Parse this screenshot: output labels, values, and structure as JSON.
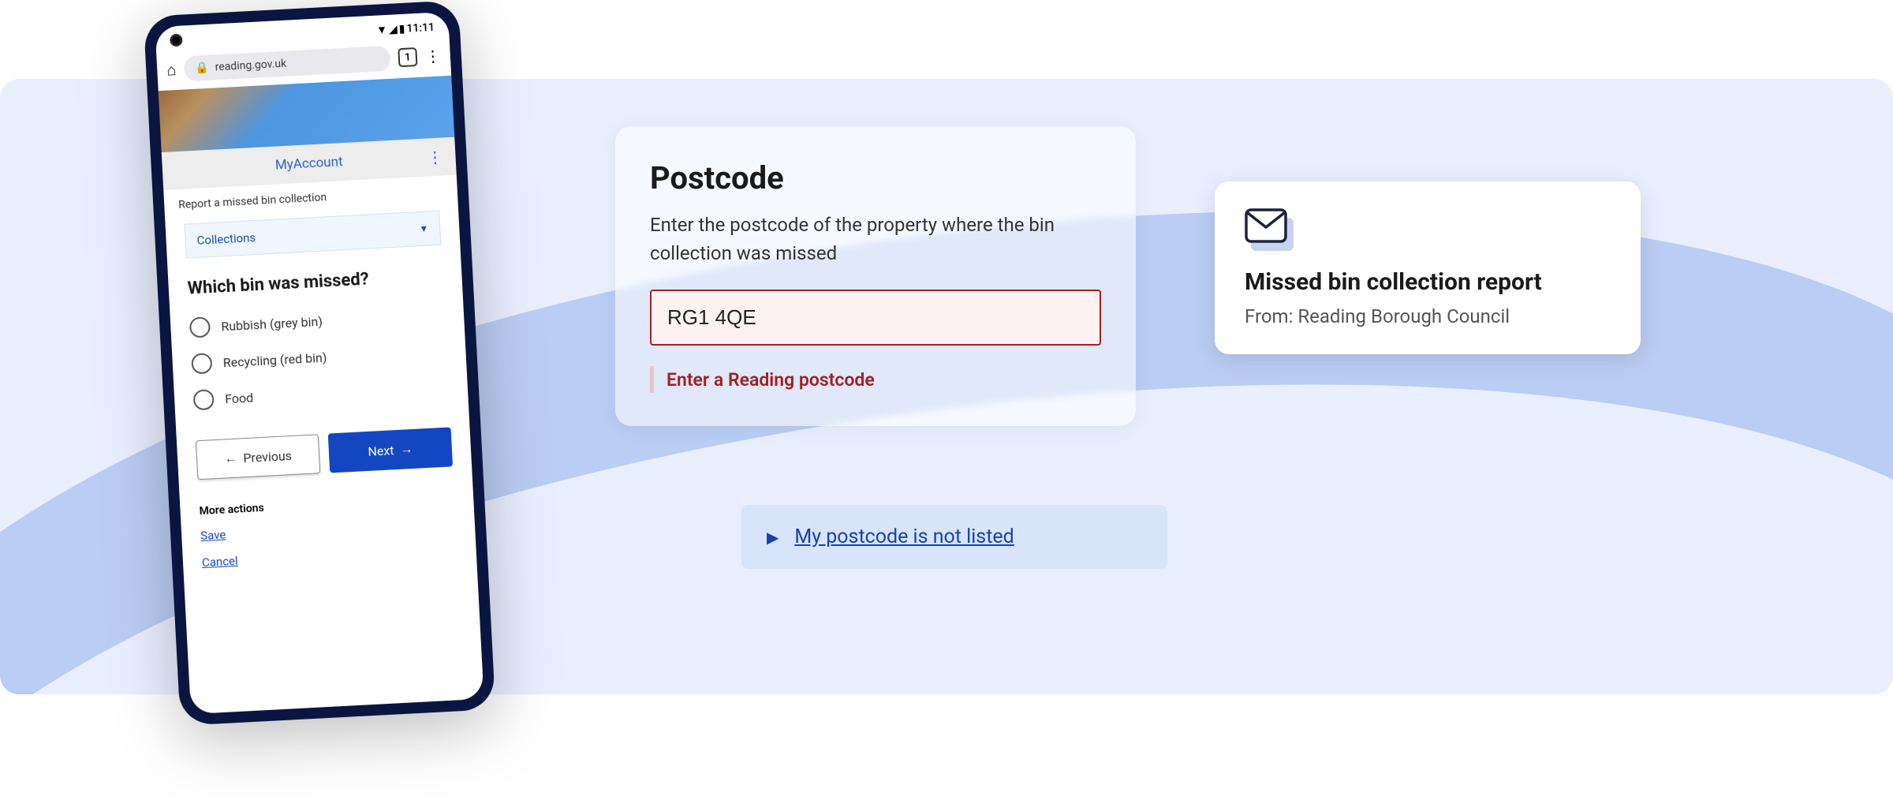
{
  "phone": {
    "status_time": "11:11",
    "url": "reading.gov.uk",
    "tab_count": "1",
    "app_title": "MyAccount",
    "breadcrumb": "Report a missed bin collection",
    "dropdown_label": "Collections",
    "question": "Which bin was missed?",
    "options": [
      "Rubbish (grey bin)",
      "Recycling (red bin)",
      "Food"
    ],
    "prev_label": "Previous",
    "next_label": "Next",
    "more_actions_label": "More actions",
    "save_label": "Save",
    "cancel_label": "Cancel"
  },
  "postcode": {
    "heading": "Postcode",
    "instruction": "Enter the postcode of the property where the bin collection was missed",
    "value": "RG1 4QE",
    "error": "Enter a Reading postcode"
  },
  "expander": {
    "label": "My postcode is not listed"
  },
  "notif": {
    "title": "Missed bin collection report",
    "from": "From: Reading Borough Council"
  }
}
